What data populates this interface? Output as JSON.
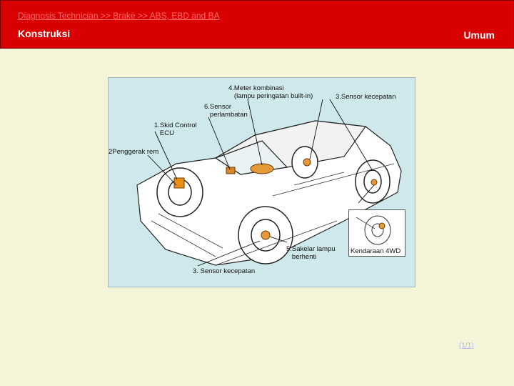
{
  "header": {
    "breadcrumb": "Diagnosis Technician >> Brake >> ABS, EBD and BA",
    "title": "Konstruksi",
    "category": "Umum"
  },
  "diagram": {
    "labels": {
      "meter": "4.Meter kombinasi\n   (lampu peringatan built-in)",
      "sensor_decel": "6.Sensor\n   perlambatan",
      "speed_sensor_top": "3.Sensor kecepatan",
      "skid_ecu": "1.Skid Control\n   ECU",
      "actuator": "2Penggerak rem",
      "stop_switch": "5.Sakelar lampu\n   berhenti",
      "speed_sensor_bottom": "3. Sensor kecepatan",
      "inset_4wd": "Kendaraan 4WD"
    }
  },
  "footer": {
    "page": "(1/1)"
  }
}
